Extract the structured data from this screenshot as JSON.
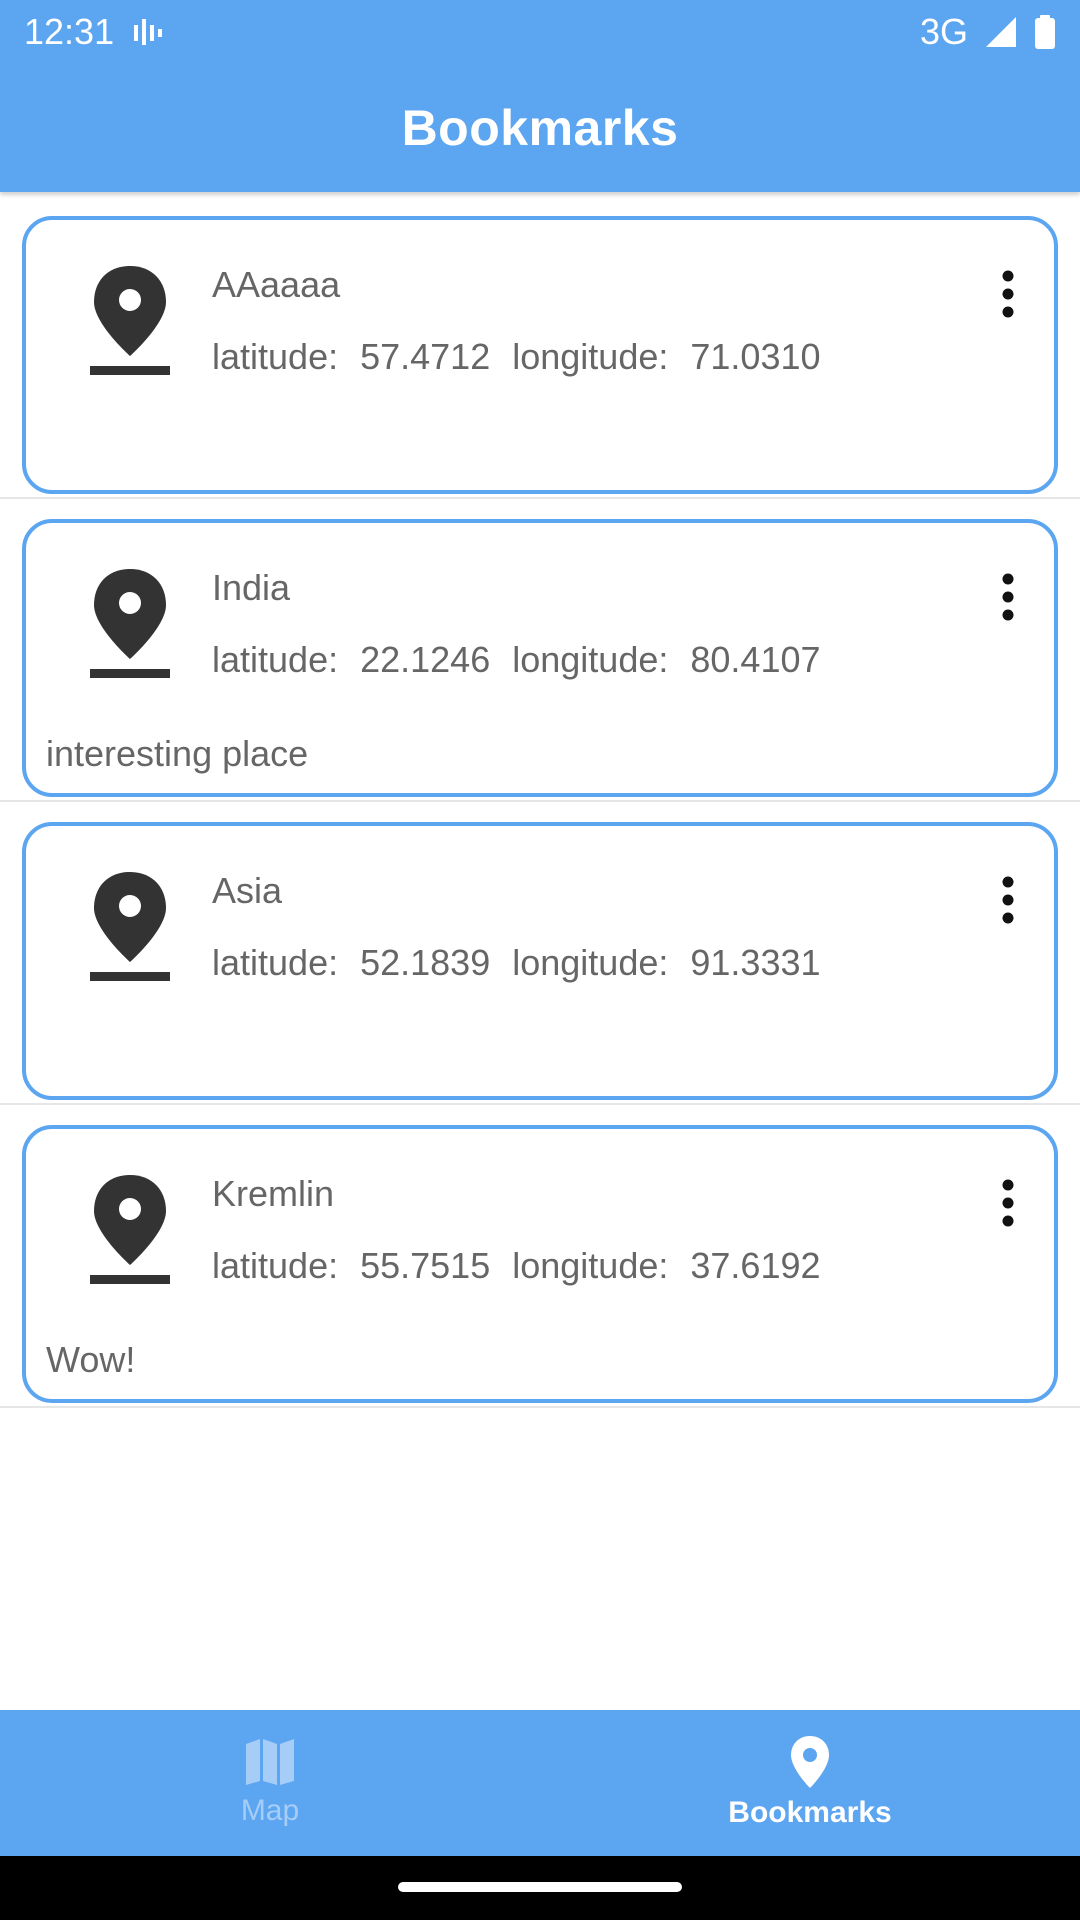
{
  "status_bar": {
    "time": "12:31",
    "network": "3G"
  },
  "app_bar": {
    "title": "Bookmarks"
  },
  "bookmarks": [
    {
      "name": "AAaaaa",
      "latitude_label": "latitude:",
      "latitude": "57.4712",
      "longitude_label": "longitude:",
      "longitude": "71.0310",
      "note": ""
    },
    {
      "name": "India",
      "latitude_label": "latitude:",
      "latitude": "22.1246",
      "longitude_label": "longitude:",
      "longitude": "80.4107",
      "note": "interesting place"
    },
    {
      "name": "Asia",
      "latitude_label": "latitude:",
      "latitude": "52.1839",
      "longitude_label": "longitude:",
      "longitude": "91.3331",
      "note": ""
    },
    {
      "name": "Kremlin",
      "latitude_label": "latitude:",
      "latitude": "55.7515",
      "longitude_label": "longitude:",
      "longitude": "37.6192",
      "note": "Wow!"
    }
  ],
  "bottom_nav": {
    "items": [
      {
        "label": "Map",
        "icon": "map-icon",
        "active": false
      },
      {
        "label": "Bookmarks",
        "icon": "location-pin-icon",
        "active": true
      }
    ]
  },
  "colors": {
    "primary": "#5ca5f0",
    "text_secondary": "#666666",
    "icon_dark": "#333333",
    "nav_inactive": "#a6cdf7"
  }
}
